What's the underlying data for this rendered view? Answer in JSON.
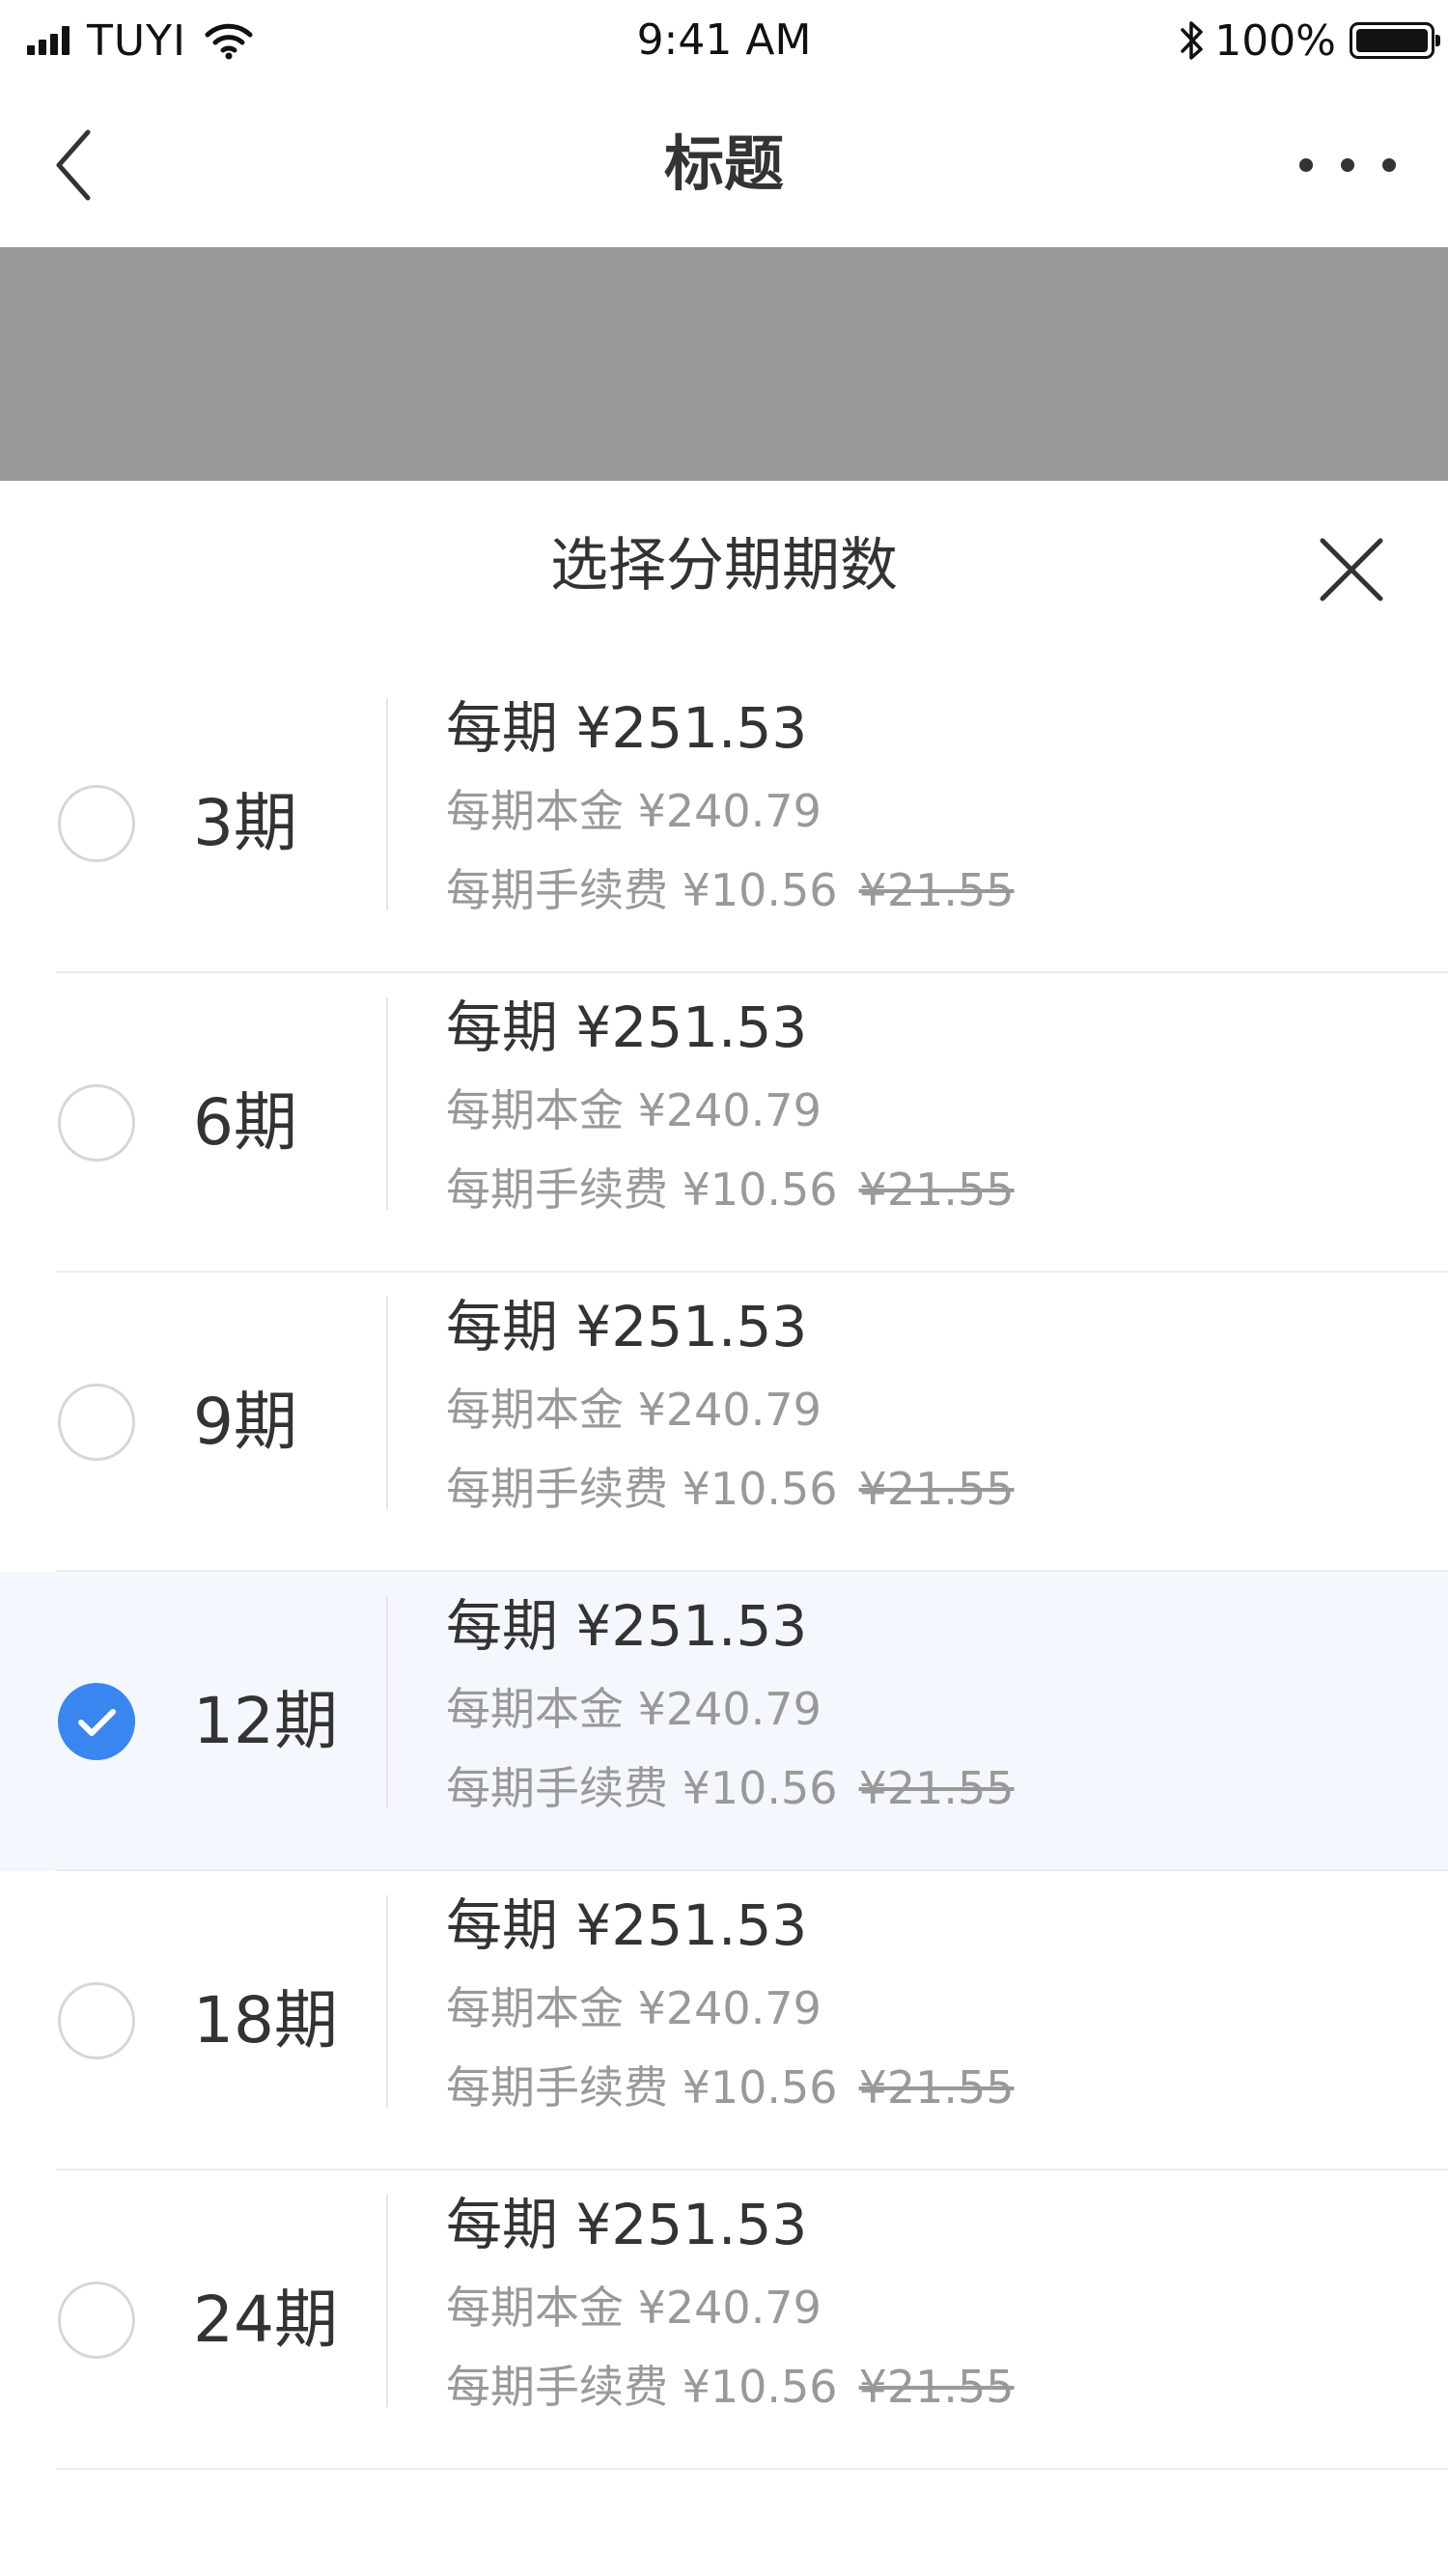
{
  "status_bar": {
    "carrier": "TUYI",
    "time": "9:41 AM",
    "battery": "100%",
    "battery_level": 1.0
  },
  "nav": {
    "title": "标题",
    "back_icon": "chevron-left-icon",
    "more_icon": "more-horizontal-icon"
  },
  "sheet": {
    "title": "选择分期期数",
    "close_icon": "close-icon"
  },
  "colors": {
    "accent": "#3a86f0",
    "selected_bg": "#f5f7ff",
    "band": "#999999"
  },
  "options": [
    {
      "period": "3期",
      "per_amount": "每期 ¥251.53",
      "principal": "每期本金 ¥240.79",
      "fee_label": "每期手续费 ¥10.56",
      "fee_original": "¥21.55",
      "selected": false
    },
    {
      "period": "6期",
      "per_amount": "每期 ¥251.53",
      "principal": "每期本金 ¥240.79",
      "fee_label": "每期手续费 ¥10.56",
      "fee_original": "¥21.55",
      "selected": false
    },
    {
      "period": "9期",
      "per_amount": "每期 ¥251.53",
      "principal": "每期本金 ¥240.79",
      "fee_label": "每期手续费 ¥10.56",
      "fee_original": "¥21.55",
      "selected": false
    },
    {
      "period": "12期",
      "per_amount": "每期 ¥251.53",
      "principal": "每期本金 ¥240.79",
      "fee_label": "每期手续费 ¥10.56",
      "fee_original": "¥21.55",
      "selected": true
    },
    {
      "period": "18期",
      "per_amount": "每期 ¥251.53",
      "principal": "每期本金 ¥240.79",
      "fee_label": "每期手续费 ¥10.56",
      "fee_original": "¥21.55",
      "selected": false
    },
    {
      "period": "24期",
      "per_amount": "每期 ¥251.53",
      "principal": "每期本金 ¥240.79",
      "fee_label": "每期手续费 ¥10.56",
      "fee_original": "¥21.55",
      "selected": false
    }
  ]
}
